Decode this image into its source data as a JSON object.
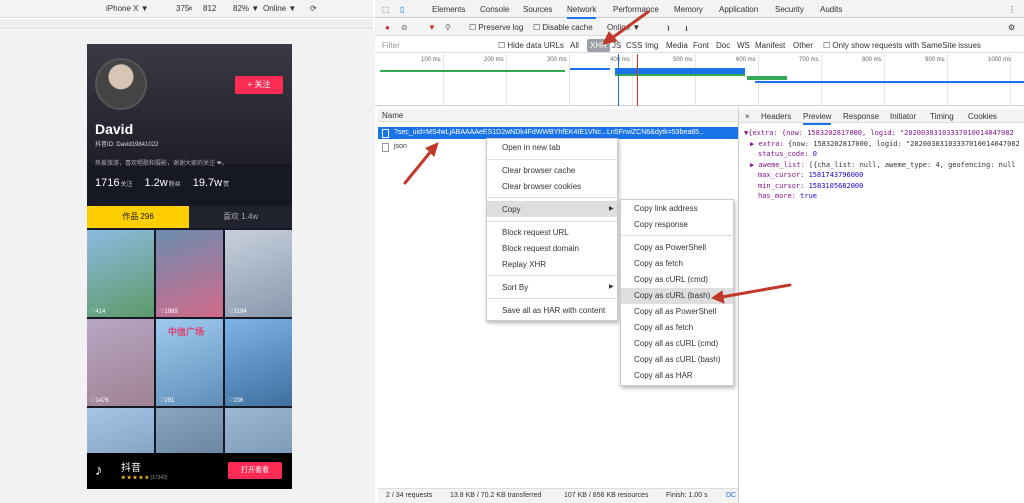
{
  "emulator": {
    "device": "iPhone X ▼",
    "width": "375",
    "times": "×",
    "height": "812",
    "zoom": "82% ▼",
    "throttle": "Online ▼"
  },
  "profile": {
    "follow": "+ 关注",
    "name": "David",
    "uid": "抖音ID:   David19841022",
    "bio": "热爱旅游，喜欢唱歌和摄影，谢谢大家的关注 ❤。",
    "stats": [
      {
        "num": "1716",
        "unit": "关注"
      },
      {
        "num": "1.2w",
        "unit": "粉丝"
      },
      {
        "num": "19.7w",
        "unit": "赞"
      }
    ],
    "tabs": [
      "作品 296",
      "喜欢 1.4w"
    ],
    "thumbs": [
      {
        "likes": "♡414",
        "color": "#6fa0c8"
      },
      {
        "likes": "♡1989",
        "color": "#c4708a"
      },
      {
        "likes": "♡3194",
        "color": "#a8b0c0"
      },
      {
        "likes": "♡1476",
        "color": "#b8a0b0"
      },
      {
        "likes": "♡291",
        "color": "#87b8e0"
      },
      {
        "likes": "♡206",
        "color": "#5a8cc0"
      },
      {
        "likes": "",
        "color": "#9ab8d8"
      },
      {
        "likes": "",
        "color": "#7a9ab8"
      },
      {
        "likes": "",
        "color": "#8aa8c8"
      }
    ],
    "overlay_text": "中信广场",
    "app_name": "抖音",
    "stars": "★ ★ ★ ★ ★",
    "rating_count": "(17342)",
    "open_app": "打开看看"
  },
  "devtools": {
    "tabs": [
      "Elements",
      "Console",
      "Sources",
      "Network",
      "Performance",
      "Memory",
      "Application",
      "Security",
      "Audits"
    ],
    "preserve_log": "Preserve log",
    "disable_cache": "Disable cache",
    "online": "Online",
    "filter_placeholder": "Filter",
    "hide_data_urls": "Hide data URLs",
    "types": [
      "All",
      "XHR",
      "JS",
      "CSS",
      "Img",
      "Media",
      "Font",
      "Doc",
      "WS",
      "Manifest",
      "Other"
    ],
    "samesite": "Only show requests with SameSite issues",
    "ticks": [
      "100 ms",
      "200 ms",
      "300 ms",
      "400 ms",
      "500 ms",
      "600 ms",
      "700 ms",
      "800 ms",
      "900 ms",
      "1000 ms"
    ],
    "name_header": "Name",
    "rows": [
      "?sec_uid=MS4wLjABAAAAeES1D2wNDk4FdWWBYhfEK4IE1VNc...Ln5FnviZCN6&dytk=53bea85...",
      "json"
    ],
    "status": {
      "requests": "2 / 34 requests",
      "transferred": "13.8 KB / 70.2 KB transferred",
      "resources": "107 KB / 856 KB resources",
      "finish": "Finish: 1.00 s",
      "dc": "DC"
    },
    "detail_tabs": [
      "×",
      "Headers",
      "Preview",
      "Response",
      "Initiator",
      "Timing",
      "Cookies"
    ],
    "preview": {
      "l1": "▼{extra: {now: 1583202817000, logid: \"20200303103337010014047082",
      "l2a": "▶ extra: ",
      "l2b": "{now: 1583202817000, logid: \"20200303103337010014047082",
      "l3k": "status_code: ",
      "l3v": "0",
      "l4a": "▶ aweme_list: ",
      "l4b": "[{cha_list: null, aweme_type: 4, geofencing: null",
      "l5k": "max_cursor: ",
      "l5v": "1581743796000",
      "l6k": "min_cursor: ",
      "l6v": "1583105682000",
      "l7k": "has_more: ",
      "l7v": "true"
    },
    "menu1": [
      "Open in new tab",
      "Clear browser cache",
      "Clear browser cookies",
      "Copy",
      "Block request URL",
      "Block request domain",
      "Replay XHR",
      "Sort By",
      "Save all as HAR with content"
    ],
    "menu2": [
      "Copy link address",
      "Copy response",
      "Copy as PowerShell",
      "Copy as fetch",
      "Copy as cURL (cmd)",
      "Copy as cURL (bash)",
      "Copy all as PowerShell",
      "Copy all as fetch",
      "Copy all as cURL (cmd)",
      "Copy all as cURL (bash)",
      "Copy all as HAR"
    ]
  },
  "colors": {
    "accent": "#fe2c55",
    "tab_yellow": "#fecf00",
    "selection": "#1a73e8",
    "annotation_arrow": "#c0392b"
  }
}
